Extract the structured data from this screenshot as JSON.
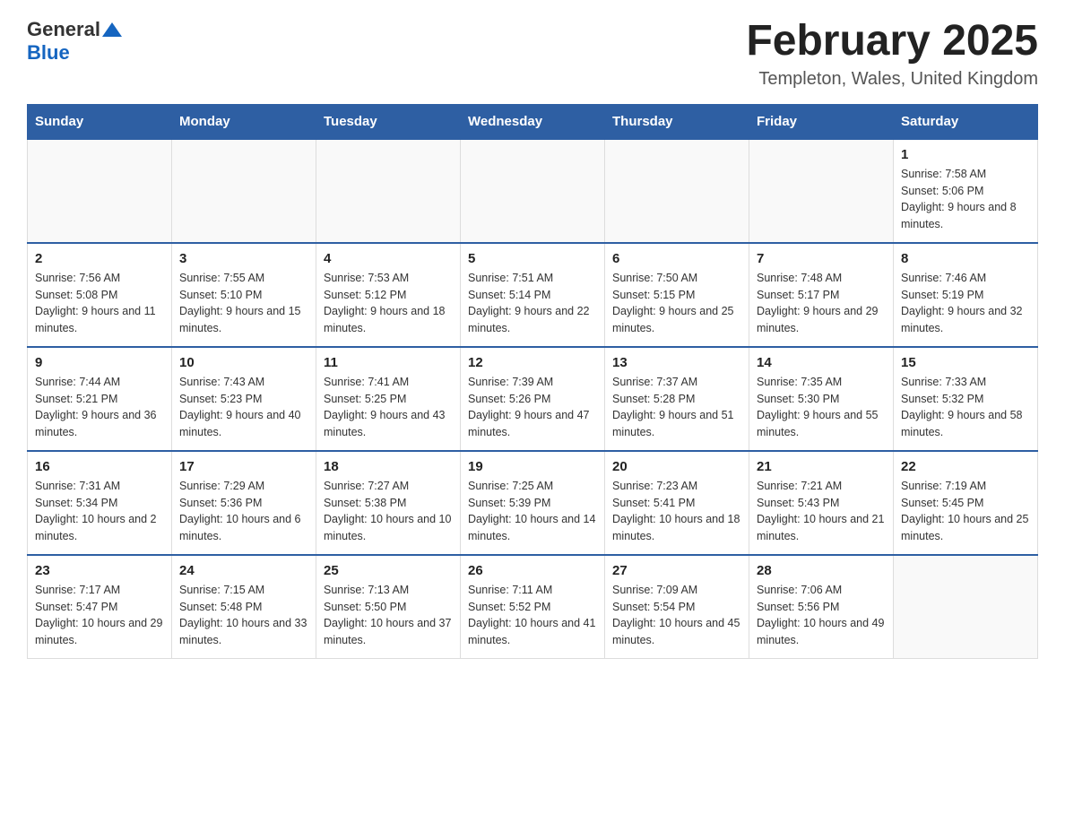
{
  "header": {
    "logo_general": "General",
    "logo_blue": "Blue",
    "month_title": "February 2025",
    "location": "Templeton, Wales, United Kingdom"
  },
  "calendar": {
    "days_of_week": [
      "Sunday",
      "Monday",
      "Tuesday",
      "Wednesday",
      "Thursday",
      "Friday",
      "Saturday"
    ],
    "weeks": [
      [
        {
          "day": "",
          "info": ""
        },
        {
          "day": "",
          "info": ""
        },
        {
          "day": "",
          "info": ""
        },
        {
          "day": "",
          "info": ""
        },
        {
          "day": "",
          "info": ""
        },
        {
          "day": "",
          "info": ""
        },
        {
          "day": "1",
          "info": "Sunrise: 7:58 AM\nSunset: 5:06 PM\nDaylight: 9 hours and 8 minutes."
        }
      ],
      [
        {
          "day": "2",
          "info": "Sunrise: 7:56 AM\nSunset: 5:08 PM\nDaylight: 9 hours and 11 minutes."
        },
        {
          "day": "3",
          "info": "Sunrise: 7:55 AM\nSunset: 5:10 PM\nDaylight: 9 hours and 15 minutes."
        },
        {
          "day": "4",
          "info": "Sunrise: 7:53 AM\nSunset: 5:12 PM\nDaylight: 9 hours and 18 minutes."
        },
        {
          "day": "5",
          "info": "Sunrise: 7:51 AM\nSunset: 5:14 PM\nDaylight: 9 hours and 22 minutes."
        },
        {
          "day": "6",
          "info": "Sunrise: 7:50 AM\nSunset: 5:15 PM\nDaylight: 9 hours and 25 minutes."
        },
        {
          "day": "7",
          "info": "Sunrise: 7:48 AM\nSunset: 5:17 PM\nDaylight: 9 hours and 29 minutes."
        },
        {
          "day": "8",
          "info": "Sunrise: 7:46 AM\nSunset: 5:19 PM\nDaylight: 9 hours and 32 minutes."
        }
      ],
      [
        {
          "day": "9",
          "info": "Sunrise: 7:44 AM\nSunset: 5:21 PM\nDaylight: 9 hours and 36 minutes."
        },
        {
          "day": "10",
          "info": "Sunrise: 7:43 AM\nSunset: 5:23 PM\nDaylight: 9 hours and 40 minutes."
        },
        {
          "day": "11",
          "info": "Sunrise: 7:41 AM\nSunset: 5:25 PM\nDaylight: 9 hours and 43 minutes."
        },
        {
          "day": "12",
          "info": "Sunrise: 7:39 AM\nSunset: 5:26 PM\nDaylight: 9 hours and 47 minutes."
        },
        {
          "day": "13",
          "info": "Sunrise: 7:37 AM\nSunset: 5:28 PM\nDaylight: 9 hours and 51 minutes."
        },
        {
          "day": "14",
          "info": "Sunrise: 7:35 AM\nSunset: 5:30 PM\nDaylight: 9 hours and 55 minutes."
        },
        {
          "day": "15",
          "info": "Sunrise: 7:33 AM\nSunset: 5:32 PM\nDaylight: 9 hours and 58 minutes."
        }
      ],
      [
        {
          "day": "16",
          "info": "Sunrise: 7:31 AM\nSunset: 5:34 PM\nDaylight: 10 hours and 2 minutes."
        },
        {
          "day": "17",
          "info": "Sunrise: 7:29 AM\nSunset: 5:36 PM\nDaylight: 10 hours and 6 minutes."
        },
        {
          "day": "18",
          "info": "Sunrise: 7:27 AM\nSunset: 5:38 PM\nDaylight: 10 hours and 10 minutes."
        },
        {
          "day": "19",
          "info": "Sunrise: 7:25 AM\nSunset: 5:39 PM\nDaylight: 10 hours and 14 minutes."
        },
        {
          "day": "20",
          "info": "Sunrise: 7:23 AM\nSunset: 5:41 PM\nDaylight: 10 hours and 18 minutes."
        },
        {
          "day": "21",
          "info": "Sunrise: 7:21 AM\nSunset: 5:43 PM\nDaylight: 10 hours and 21 minutes."
        },
        {
          "day": "22",
          "info": "Sunrise: 7:19 AM\nSunset: 5:45 PM\nDaylight: 10 hours and 25 minutes."
        }
      ],
      [
        {
          "day": "23",
          "info": "Sunrise: 7:17 AM\nSunset: 5:47 PM\nDaylight: 10 hours and 29 minutes."
        },
        {
          "day": "24",
          "info": "Sunrise: 7:15 AM\nSunset: 5:48 PM\nDaylight: 10 hours and 33 minutes."
        },
        {
          "day": "25",
          "info": "Sunrise: 7:13 AM\nSunset: 5:50 PM\nDaylight: 10 hours and 37 minutes."
        },
        {
          "day": "26",
          "info": "Sunrise: 7:11 AM\nSunset: 5:52 PM\nDaylight: 10 hours and 41 minutes."
        },
        {
          "day": "27",
          "info": "Sunrise: 7:09 AM\nSunset: 5:54 PM\nDaylight: 10 hours and 45 minutes."
        },
        {
          "day": "28",
          "info": "Sunrise: 7:06 AM\nSunset: 5:56 PM\nDaylight: 10 hours and 49 minutes."
        },
        {
          "day": "",
          "info": ""
        }
      ]
    ]
  }
}
